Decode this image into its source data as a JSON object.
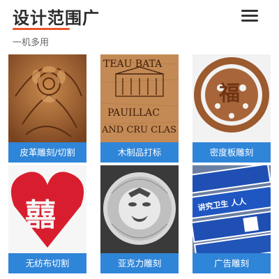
{
  "header": {
    "title": "设计范围广",
    "subtitle": "一机多用",
    "menu_icon": "hamburger-menu-icon",
    "accent_color": "#e8552a"
  },
  "grid": {
    "label_color": "#2f85d8",
    "items": [
      {
        "label": "皮革雕刻/切割",
        "image_text": ""
      },
      {
        "label": "木制品打标",
        "image_text": "TEAU BATA PAUILLAC AND CRU CLAS"
      },
      {
        "label": "密度板雕刻",
        "image_text": "福"
      },
      {
        "label": "无纺布切割",
        "image_text": "囍"
      },
      {
        "label": "亚克力雕刻",
        "image_text": ""
      },
      {
        "label": "广告雕刻",
        "image_text": "讲究卫生 人人"
      }
    ]
  }
}
